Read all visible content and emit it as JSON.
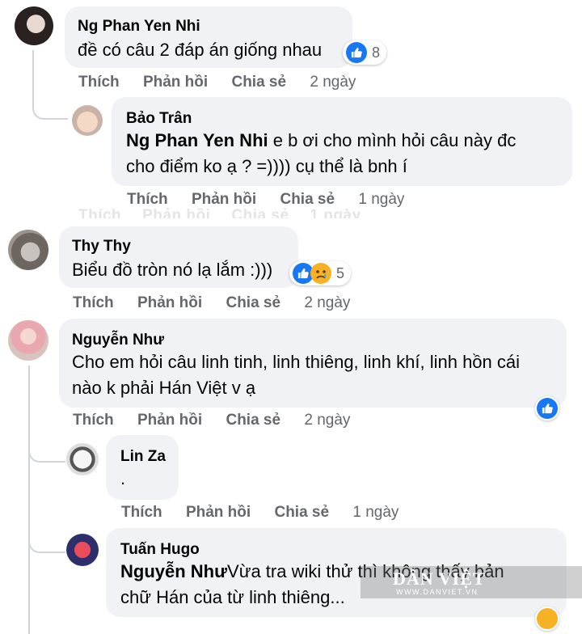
{
  "comments": [
    {
      "name": "Ng Phan Yen Nhi",
      "text": "đề có câu 2 đáp án giống nhau",
      "reaction_count": "8",
      "actions": {
        "like": "Thích",
        "reply": "Phản hồi",
        "share": "Chia sẻ",
        "time": "2 ngày"
      }
    },
    {
      "name": "Bảo Trân",
      "mention": "Ng Phan Yen Nhi",
      "text_line1": " e b ơi cho mình hỏi câu này đc",
      "text_line2": "cho điểm ko ạ ? =)))) cụ thể là bnh í",
      "actions": {
        "like": "Thích",
        "reply": "Phản hồi",
        "share": "Chia sẻ",
        "time": "1 ngày"
      }
    },
    {
      "name": "Thy Thy",
      "text": "Biểu đồ tròn nó lạ lắm :)))",
      "reaction_count": "5",
      "actions": {
        "like": "Thích",
        "reply": "Phản hồi",
        "share": "Chia sẻ",
        "time": "2 ngày"
      }
    },
    {
      "name": "Nguyễn Như",
      "text_line1": "Cho em hỏi câu linh tinh, linh thiêng, linh khí, linh hồn cái",
      "text_line2": "nào k phải Hán Việt v ạ",
      "actions": {
        "like": "Thích",
        "reply": "Phản hồi",
        "share": "Chia sẻ",
        "time": "2 ngày"
      }
    },
    {
      "name": "Lin Za",
      "text": ".",
      "actions": {
        "like": "Thích",
        "reply": "Phản hồi",
        "share": "Chia sẻ",
        "time": "1 ngày"
      }
    },
    {
      "name": "Tuấn Hugo",
      "mention": "Nguyễn Như",
      "text_line1": "Vừa tra wiki thử thì không thấy bản",
      "text_line2": "chữ Hán của từ linh thiêng..."
    }
  ],
  "ghost_actions": {
    "like": "Thích",
    "reply": "Phản hồi",
    "share": "Chia sẻ",
    "time": "1 ngày"
  },
  "watermark": {
    "brand": "DÂN VIỆT",
    "url": "WWW.DANVIET.VN"
  },
  "colors": {
    "like_blue": "#1877f2",
    "bubble": "#f0f2f5",
    "meta_gray": "#65676b",
    "sad_yellow": "#f7b125"
  }
}
